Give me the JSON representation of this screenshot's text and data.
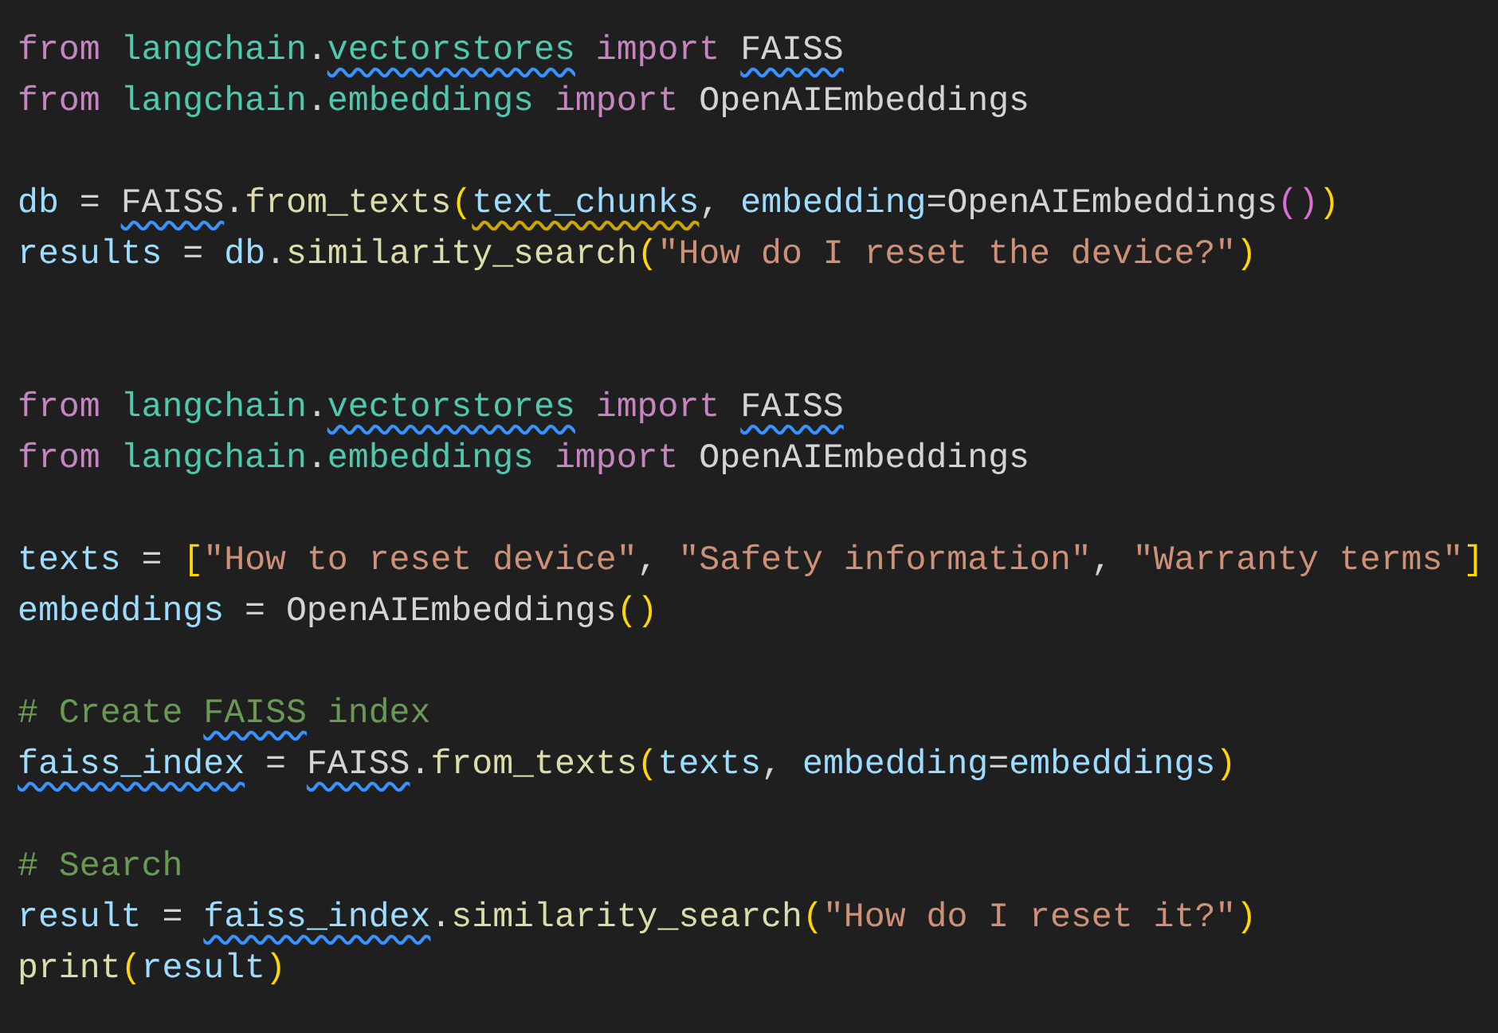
{
  "editor": {
    "lines": [
      {
        "kind": "code",
        "tokens": [
          {
            "text": "from ",
            "kind": "keyword"
          },
          {
            "text": "langchain",
            "kind": "module"
          },
          {
            "text": ".",
            "kind": "plain"
          },
          {
            "text": "vectorstores",
            "kind": "module",
            "info_underline": true
          },
          {
            "text": " import ",
            "kind": "keyword"
          },
          {
            "text": "FAISS",
            "kind": "plain",
            "info_underline": true
          }
        ]
      },
      {
        "kind": "code",
        "tokens": [
          {
            "text": "from ",
            "kind": "keyword"
          },
          {
            "text": "langchain",
            "kind": "module"
          },
          {
            "text": ".",
            "kind": "plain"
          },
          {
            "text": "embeddings",
            "kind": "module"
          },
          {
            "text": " import",
            "kind": "keyword"
          },
          {
            "text": " OpenAIEmbeddings",
            "kind": "plain"
          }
        ]
      },
      {
        "kind": "blank"
      },
      {
        "kind": "code",
        "tokens": [
          {
            "text": "db",
            "kind": "variable"
          },
          {
            "text": " = ",
            "kind": "plain"
          },
          {
            "text": "FAISS",
            "kind": "plain",
            "info_underline": true
          },
          {
            "text": ".",
            "kind": "plain"
          },
          {
            "text": "from_texts",
            "kind": "function"
          },
          {
            "text": "(",
            "kind": "bracket"
          },
          {
            "text": "text_chunks",
            "kind": "variable",
            "warning_underline": true
          },
          {
            "text": ", ",
            "kind": "plain"
          },
          {
            "text": "embedding",
            "kind": "variable"
          },
          {
            "text": "=OpenAIEmbeddings",
            "kind": "plain"
          },
          {
            "text": "()",
            "kind": "bracket2"
          },
          {
            "text": ")",
            "kind": "bracket"
          }
        ]
      },
      {
        "kind": "code",
        "tokens": [
          {
            "text": "results",
            "kind": "variable"
          },
          {
            "text": " = ",
            "kind": "plain"
          },
          {
            "text": "db",
            "kind": "variable"
          },
          {
            "text": ".",
            "kind": "plain"
          },
          {
            "text": "similarity_search",
            "kind": "function"
          },
          {
            "text": "(",
            "kind": "bracket"
          },
          {
            "text": "\"How do I reset the device?\"",
            "kind": "string"
          },
          {
            "text": ")",
            "kind": "bracket"
          }
        ]
      },
      {
        "kind": "blank"
      },
      {
        "kind": "blank"
      },
      {
        "kind": "code",
        "tokens": [
          {
            "text": "from ",
            "kind": "keyword"
          },
          {
            "text": "langchain",
            "kind": "module"
          },
          {
            "text": ".",
            "kind": "plain"
          },
          {
            "text": "vectorstores",
            "kind": "module",
            "info_underline": true
          },
          {
            "text": " import ",
            "kind": "keyword"
          },
          {
            "text": "FAISS",
            "kind": "plain",
            "info_underline": true
          }
        ]
      },
      {
        "kind": "code",
        "tokens": [
          {
            "text": "from ",
            "kind": "keyword"
          },
          {
            "text": "langchain",
            "kind": "module"
          },
          {
            "text": ".",
            "kind": "plain"
          },
          {
            "text": "embeddings",
            "kind": "module"
          },
          {
            "text": " import",
            "kind": "keyword"
          },
          {
            "text": " OpenAIEmbeddings",
            "kind": "plain"
          }
        ]
      },
      {
        "kind": "blank"
      },
      {
        "kind": "code",
        "tokens": [
          {
            "text": "texts",
            "kind": "variable"
          },
          {
            "text": " = ",
            "kind": "plain"
          },
          {
            "text": "[",
            "kind": "bracket"
          },
          {
            "text": "\"How to reset device\"",
            "kind": "string"
          },
          {
            "text": ", ",
            "kind": "plain"
          },
          {
            "text": "\"Safety information\"",
            "kind": "string"
          },
          {
            "text": ", ",
            "kind": "plain"
          },
          {
            "text": "\"Warranty terms\"",
            "kind": "string"
          },
          {
            "text": "]",
            "kind": "bracket"
          }
        ]
      },
      {
        "kind": "code",
        "tokens": [
          {
            "text": "embeddings",
            "kind": "variable"
          },
          {
            "text": " = OpenAIEmbeddings",
            "kind": "plain"
          },
          {
            "text": "()",
            "kind": "bracket"
          }
        ]
      },
      {
        "kind": "blank"
      },
      {
        "kind": "code",
        "tokens": [
          {
            "text": "# Create ",
            "kind": "comment"
          },
          {
            "text": "FAISS",
            "kind": "comment",
            "info_underline": true
          },
          {
            "text": " index",
            "kind": "comment"
          }
        ]
      },
      {
        "kind": "code",
        "tokens": [
          {
            "text": "faiss_index",
            "kind": "variable",
            "info_underline": true
          },
          {
            "text": " = ",
            "kind": "plain"
          },
          {
            "text": "FAISS",
            "kind": "plain",
            "info_underline": true
          },
          {
            "text": ".",
            "kind": "plain"
          },
          {
            "text": "from_texts",
            "kind": "function"
          },
          {
            "text": "(",
            "kind": "bracket"
          },
          {
            "text": "texts",
            "kind": "variable"
          },
          {
            "text": ", ",
            "kind": "plain"
          },
          {
            "text": "embedding",
            "kind": "variable"
          },
          {
            "text": "=",
            "kind": "plain"
          },
          {
            "text": "embeddings",
            "kind": "variable"
          },
          {
            "text": ")",
            "kind": "bracket"
          }
        ]
      },
      {
        "kind": "blank"
      },
      {
        "kind": "code",
        "tokens": [
          {
            "text": "# Search",
            "kind": "comment"
          }
        ]
      },
      {
        "kind": "code",
        "tokens": [
          {
            "text": "result",
            "kind": "variable"
          },
          {
            "text": " = ",
            "kind": "plain"
          },
          {
            "text": "faiss_index",
            "kind": "variable",
            "info_underline": true
          },
          {
            "text": ".",
            "kind": "plain"
          },
          {
            "text": "similarity_search",
            "kind": "function"
          },
          {
            "text": "(",
            "kind": "bracket"
          },
          {
            "text": "\"How do I reset it?\"",
            "kind": "string"
          },
          {
            "text": ")",
            "kind": "bracket"
          }
        ]
      },
      {
        "kind": "code",
        "tokens": [
          {
            "text": "print",
            "kind": "function"
          },
          {
            "text": "(",
            "kind": "bracket"
          },
          {
            "text": "result",
            "kind": "variable"
          },
          {
            "text": ")",
            "kind": "bracket"
          }
        ]
      }
    ]
  }
}
